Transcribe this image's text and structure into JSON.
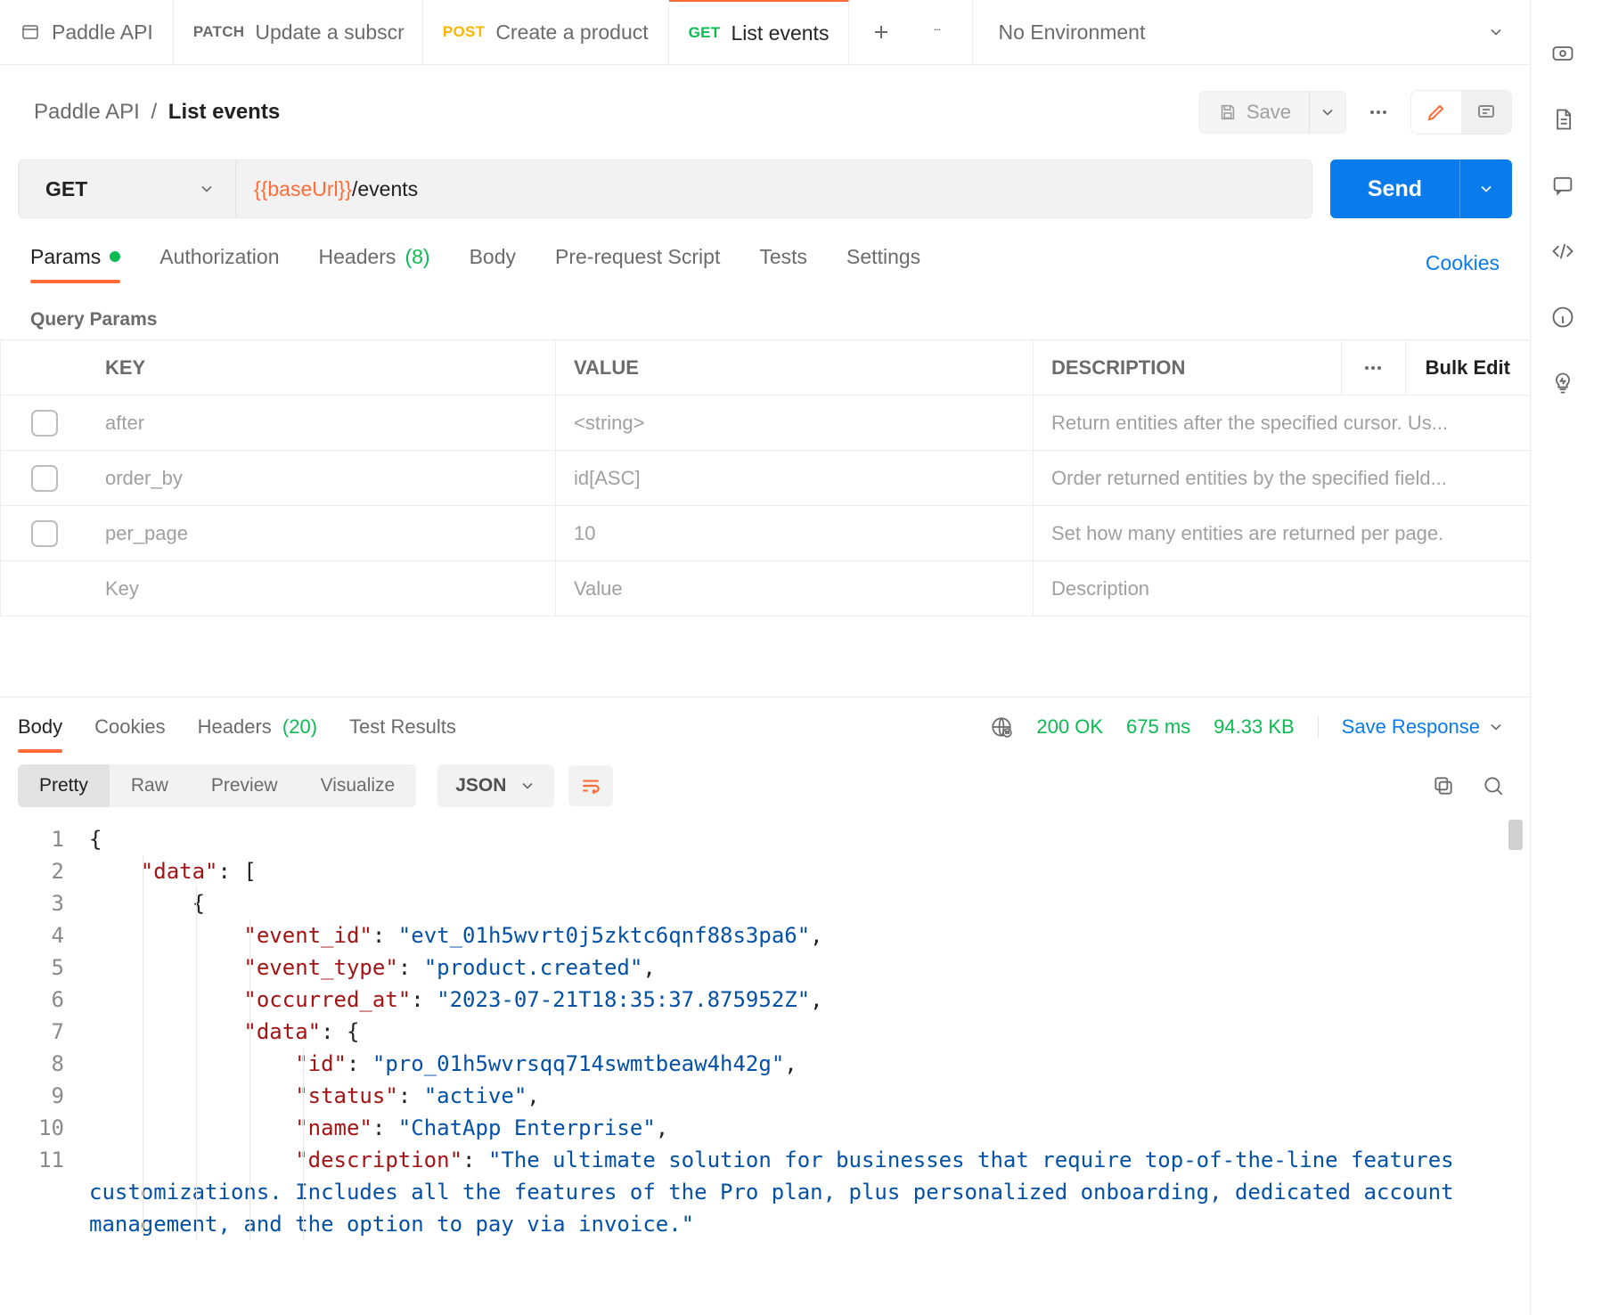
{
  "tabs": [
    {
      "type": "collection",
      "label": "Paddle API"
    },
    {
      "type": "request",
      "method": "PATCH",
      "method_class": "patch",
      "label": "Update a subscr"
    },
    {
      "type": "request",
      "method": "POST",
      "method_class": "post",
      "label": "Create a product"
    },
    {
      "type": "request",
      "method": "GET",
      "method_class": "get",
      "label": "List events",
      "active": true
    }
  ],
  "env": {
    "selected": "No Environment"
  },
  "breadcrumb": {
    "parent": "Paddle API",
    "sep": "/",
    "current": "List events"
  },
  "header_actions": {
    "save": "Save"
  },
  "request": {
    "method": "GET",
    "url_var": "{{baseUrl}}",
    "url_path": "/events",
    "send": "Send"
  },
  "req_tabs": {
    "params": "Params",
    "authorization": "Authorization",
    "headers": "Headers",
    "headers_count": "(8)",
    "body": "Body",
    "prerequest": "Pre-request Script",
    "tests": "Tests",
    "settings": "Settings",
    "cookies": "Cookies"
  },
  "query_params": {
    "section_label": "Query Params",
    "header": {
      "key": "KEY",
      "value": "VALUE",
      "description": "DESCRIPTION",
      "bulk_edit": "Bulk Edit"
    },
    "rows": [
      {
        "key": "after",
        "value": "<string>",
        "description": "Return entities after the specified cursor. Us..."
      },
      {
        "key": "order_by",
        "value": "id[ASC]",
        "description": "Order returned entities by the specified field..."
      },
      {
        "key": "per_page",
        "value": "10",
        "description": "Set how many entities are returned per page."
      }
    ],
    "placeholder": {
      "key": "Key",
      "value": "Value",
      "description": "Description"
    }
  },
  "response": {
    "tabs": {
      "body": "Body",
      "cookies": "Cookies",
      "headers": "Headers",
      "headers_count": "(20)",
      "test_results": "Test Results"
    },
    "status": "200 OK",
    "time": "675 ms",
    "size": "94.33 KB",
    "save": "Save Response",
    "view_modes": {
      "pretty": "Pretty",
      "raw": "Raw",
      "preview": "Preview",
      "visualize": "Visualize"
    },
    "format": "JSON",
    "body_json": {
      "data": [
        {
          "event_id": "evt_01h5wvrt0j5zktc6qnf88s3pa6",
          "event_type": "product.created",
          "occurred_at": "2023-07-21T18:35:37.875952Z",
          "data": {
            "id": "pro_01h5wvrsqq714swmtbeaw4h42g",
            "status": "active",
            "name": "ChatApp Enterprise",
            "description": "The ultimate solution for businesses that require top-of-the-line features customizations. Includes all the features of the Pro plan, plus personalized onboarding, dedicated account management, and the option to pay via invoice."
          }
        }
      ]
    },
    "code_lines": [
      {
        "n": "1",
        "indent": 0,
        "raw": "{"
      },
      {
        "n": "2",
        "indent": 1,
        "key": "\"data\"",
        "after": ": ["
      },
      {
        "n": "3",
        "indent": 2,
        "raw": "{"
      },
      {
        "n": "4",
        "indent": 3,
        "key": "\"event_id\"",
        "colon": ": ",
        "str": "\"evt_01h5wvrt0j5zktc6qnf88s3pa6\"",
        "comma": ","
      },
      {
        "n": "5",
        "indent": 3,
        "key": "\"event_type\"",
        "colon": ": ",
        "str": "\"product.created\"",
        "comma": ","
      },
      {
        "n": "6",
        "indent": 3,
        "key": "\"occurred_at\"",
        "colon": ": ",
        "str": "\"2023-07-21T18:35:37.875952Z\"",
        "comma": ","
      },
      {
        "n": "7",
        "indent": 3,
        "key": "\"data\"",
        "after": ": {"
      },
      {
        "n": "8",
        "indent": 4,
        "key": "\"id\"",
        "colon": ": ",
        "str": "\"pro_01h5wvrsqq714swmtbeaw4h42g\"",
        "comma": ","
      },
      {
        "n": "9",
        "indent": 4,
        "key": "\"status\"",
        "colon": ": ",
        "str": "\"active\"",
        "comma": ","
      },
      {
        "n": "10",
        "indent": 4,
        "key": "\"name\"",
        "colon": ": ",
        "str": "\"ChatApp Enterprise\"",
        "comma": ","
      },
      {
        "n": "11",
        "indent": 4,
        "key": "\"description\"",
        "colon": ": ",
        "str": "\"The ultimate solution for businesses that require top-of-the-line features customizations. Includes all the features of the Pro plan, plus personalized onboarding, dedicated account management, and the option to pay via invoice.\""
      }
    ]
  }
}
